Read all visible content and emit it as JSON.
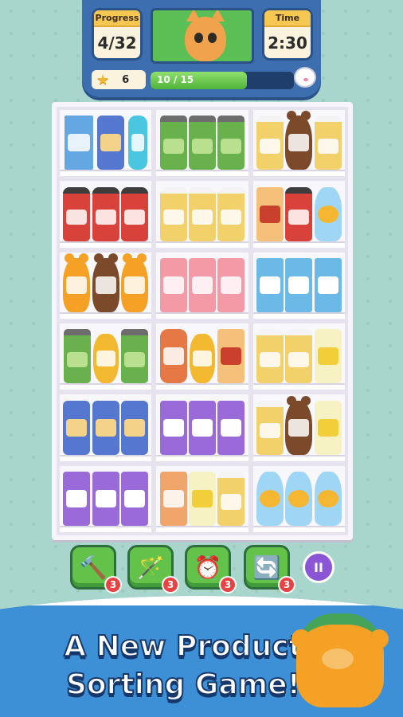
{
  "hud": {
    "progress_label": "Progress",
    "progress_value": "4/32",
    "time_label": "Time",
    "time_value": "2:30",
    "stars": "6",
    "bar_text": "10 / 15",
    "bar_fraction": 0.67
  },
  "shelf": {
    "rows": [
      [
        [
          "cereal",
          "pet",
          "bottle"
        ],
        [
          "can",
          "can",
          "can"
        ],
        [
          "honey",
          "bear brown",
          "honey"
        ]
      ],
      [
        [
          "ketchup",
          "ketchup",
          "ketchup"
        ],
        [
          "honey",
          "honey",
          "honey"
        ],
        [
          "hotdog",
          "ketchup",
          "fish"
        ]
      ],
      [
        [
          "bear",
          "bear brown",
          "bear"
        ],
        [
          "pink",
          "pink",
          "pink"
        ],
        [
          "milk",
          "milk",
          "milk"
        ]
      ],
      [
        [
          "can",
          "coin",
          "can"
        ],
        [
          "sauce",
          "coin",
          "hotdog"
        ],
        [
          "honey",
          "honey",
          "wrap"
        ]
      ],
      [
        [
          "pet",
          "pet",
          "pet"
        ],
        [
          "purple",
          "purple",
          "purple"
        ],
        [
          "honey",
          "bear brown",
          "wrap"
        ]
      ],
      [
        [
          "purple",
          "purple",
          "purple"
        ],
        [
          "cup",
          "wrap",
          "honey"
        ],
        [
          "fish",
          "fish",
          "fish"
        ]
      ]
    ]
  },
  "boosters": [
    {
      "name": "hammer",
      "icon": "🔨",
      "count": "3"
    },
    {
      "name": "magic-wand",
      "icon": "🪄",
      "count": "3"
    },
    {
      "name": "clock",
      "icon": "⏰",
      "count": "3"
    },
    {
      "name": "shuffle",
      "icon": "🔄",
      "count": "3"
    }
  ],
  "pause_icon": "II",
  "banner": {
    "line1": "A New Product",
    "line2": "Sorting Game!"
  }
}
